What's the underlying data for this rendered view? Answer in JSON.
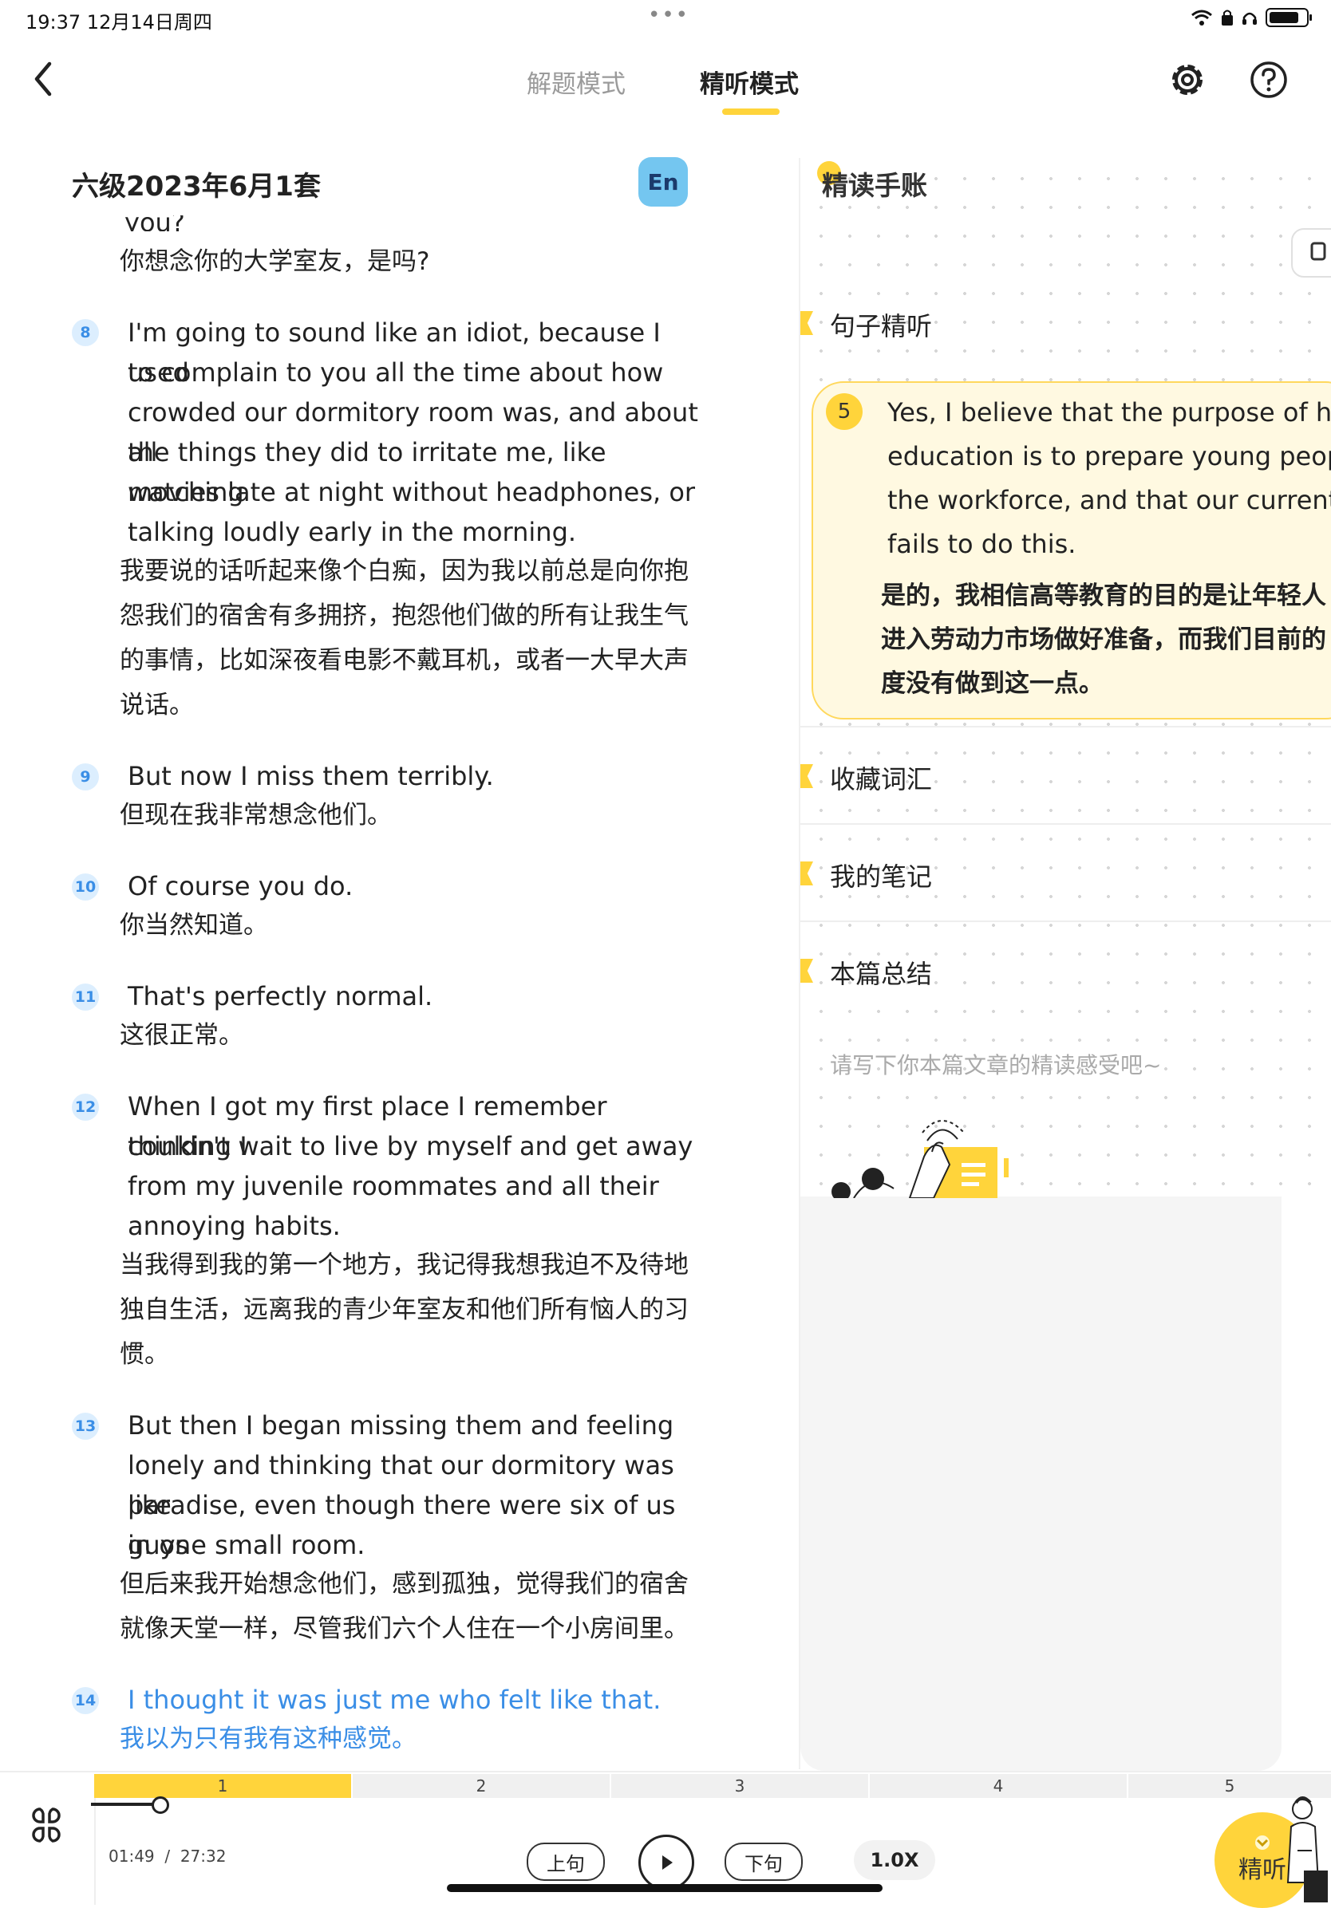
{
  "status_bar": {
    "time_date": "19:37   12月14日周四",
    "dots": "•••"
  },
  "header": {
    "tabs": [
      {
        "label": "解题模式"
      },
      {
        "label": "精听模式"
      }
    ]
  },
  "left": {
    "title": "六级2023年6月1套",
    "lang_toggle": "En",
    "cut_line": "you?",
    "cut_cn": "你想念你的大学室友，是吗?",
    "sentences": [
      {
        "num": "8",
        "en": [
          "I'm going to sound like an idiot, because I used",
          "to complain to you all the time about how",
          "crowded our dormitory room was, and about all",
          "the things they did to irritate me, like watching",
          "movies late at night without headphones, or",
          "talking loudly early in the morning."
        ],
        "cn": [
          "我要说的话听起来像个白痴，因为我以前总是向你抱",
          "怨我们的宿舍有多拥挤，抱怨他们做的所有让我生气",
          "的事情，比如深夜看电影不戴耳机，或者一大早大声",
          "说话。"
        ]
      },
      {
        "num": "9",
        "en": [
          "But now I miss them terribly."
        ],
        "cn": [
          "但现在我非常想念他们。"
        ]
      },
      {
        "num": "10",
        "en": [
          "Of course you do."
        ],
        "cn": [
          "你当然知道。"
        ]
      },
      {
        "num": "11",
        "en": [
          "That's perfectly normal."
        ],
        "cn": [
          "这很正常。"
        ]
      },
      {
        "num": "12",
        "en": [
          "When I got my first place I remember thinking I",
          "couldn't wait to live by myself and get away",
          "from my juvenile roommates and all their",
          "annoying habits."
        ],
        "cn": [
          "当我得到我的第一个地方，我记得我想我迫不及待地",
          "独自生活，远离我的青少年室友和他们所有恼人的习",
          "惯。"
        ]
      },
      {
        "num": "13",
        "en": [
          "But then I began missing them and feeling",
          "lonely and thinking that our dormitory was like",
          "paradise, even though there were six of us guys",
          "in one small room."
        ],
        "cn": [
          "但后来我开始想念他们，感到孤独，觉得我们的宿舍",
          "就像天堂一样，尽管我们六个人住在一个小房间里。"
        ]
      },
      {
        "num": "14",
        "en": [
          "I thought it was just me who felt like that."
        ],
        "cn": [
          "我以为只有我有这种感觉。"
        ]
      }
    ]
  },
  "notebook": {
    "title": "精读手账",
    "sections": {
      "sentence": "句子精听",
      "vocab": "收藏词汇",
      "notes": "我的笔记",
      "summary": "本篇总结"
    },
    "card": {
      "num": "5",
      "en": [
        "Yes, I believe that the purpose of hi",
        "education is to prepare young people",
        "the workforce, and that our current s",
        "fails to do this."
      ],
      "cn": [
        "是的，我相信高等教育的目的是让年轻人",
        "进入劳动力市场做好准备，而我们目前的",
        "度没有做到这一点。"
      ]
    },
    "summary_placeholder": "请写下你本篇文章的精读感受吧~"
  },
  "player": {
    "segments": [
      "1",
      "2",
      "3",
      "4",
      "5"
    ],
    "current_time": "01:49",
    "separator": "/",
    "total_time": "27:32",
    "prev_label": "上句",
    "next_label": "下句",
    "speed": "1.0X",
    "fab_label": "精听",
    "progress": 0.02
  },
  "colors": {
    "accent": "#ffd43b",
    "highlight_blue": "#3a8ee6",
    "en_button": "#74c6f0"
  }
}
